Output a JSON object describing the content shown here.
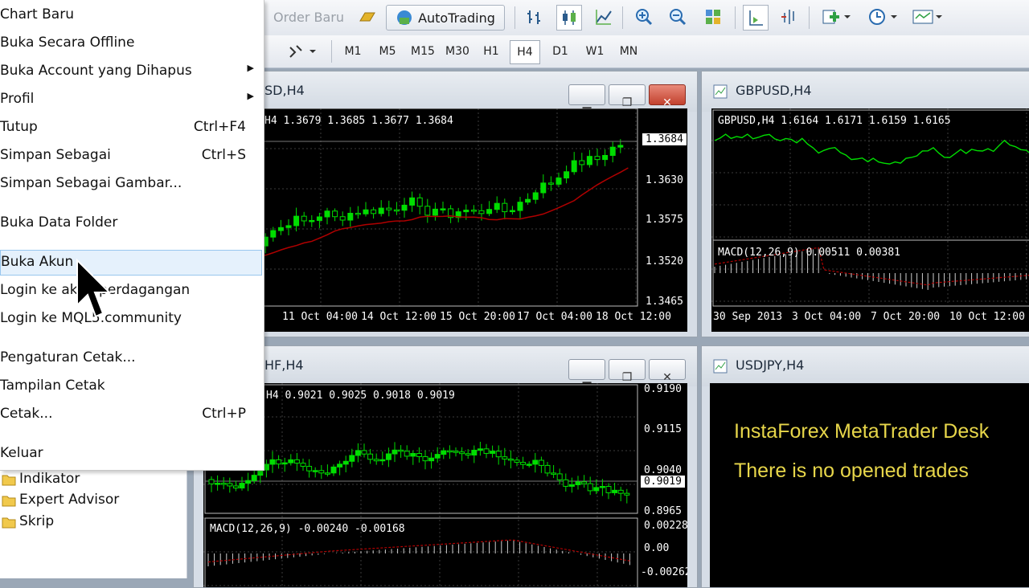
{
  "toolbar": {
    "order_baru": "Order Baru",
    "autotrading": "AutoTrading",
    "timeframes": [
      "M1",
      "M5",
      "M15",
      "M30",
      "H1",
      "H4",
      "D1",
      "W1",
      "MN"
    ],
    "selected_timeframe": "H4"
  },
  "file_menu": {
    "items": [
      {
        "label": "Chart Baru",
        "shortcut": ""
      },
      {
        "label": "Buka Secara Offline",
        "shortcut": ""
      },
      {
        "label": "Buka Account yang Dihapus",
        "shortcut": "",
        "submenu": true
      },
      {
        "label": "Profil",
        "shortcut": "",
        "submenu": true
      },
      {
        "label": "Tutup",
        "shortcut": "Ctrl+F4"
      },
      {
        "label": "Simpan Sebagai",
        "shortcut": "Ctrl+S"
      },
      {
        "label": "Simpan Sebagai Gambar...",
        "shortcut": ""
      },
      {
        "label": "Buka Data Folder",
        "shortcut": ""
      },
      {
        "label": "Buka Akun",
        "shortcut": "",
        "highlighted": true
      },
      {
        "label": "Login ke akun perdagangan",
        "shortcut": ""
      },
      {
        "label": "Login ke MQL5.community",
        "shortcut": ""
      },
      {
        "label": "Pengaturan Cetak...",
        "shortcut": ""
      },
      {
        "label": "Tampilan Cetak",
        "shortcut": ""
      },
      {
        "label": "Cetak...",
        "shortcut": "Ctrl+P"
      },
      {
        "label": "Keluar",
        "shortcut": ""
      }
    ]
  },
  "navigator": {
    "items": [
      "Indikator",
      "Expert Advisor",
      "Skrip"
    ]
  },
  "windows": {
    "eurusd": {
      "title": "SD,H4",
      "ohlc": "H4  1.3679 1.3685 1.3677 1.3684",
      "current_price": "1.3684",
      "price_labels": [
        "1.3630",
        "1.3575",
        "1.3520",
        "1.3465"
      ],
      "time_labels": [
        "11 Oct 04:00",
        "14 Oct 12:00",
        "15 Oct 20:00",
        "17 Oct 04:00",
        "18 Oct 12:00"
      ]
    },
    "gbpusd": {
      "title": "GBPUSD,H4",
      "ohlc": "GBPUSD,H4  1.6164 1.6171 1.6159 1.6165",
      "macd": "MACD(12,26,9) 0.00511 0.00381",
      "time_labels": [
        "30 Sep 2013",
        "3 Oct 04:00",
        "7 Oct 20:00",
        "10 Oct 12:00"
      ]
    },
    "usdchf": {
      "title": "HF,H4",
      "ohlc": "H4  0.9021 0.9025 0.9018 0.9019",
      "current_price": "0.9019",
      "price_labels": [
        "0.9190",
        "0.9115",
        "0.9040",
        "0.8965"
      ],
      "macd": "MACD(12,26,9) -0.00240 -0.00168",
      "macd_labels": [
        "0.00228",
        "0.00",
        "-0.00262"
      ]
    },
    "usdjpy": {
      "title": "USDJPY,H4",
      "message_line1": "InstaForex MetaTrader Desk",
      "message_line2": "There is no opened trades"
    }
  },
  "colors": {
    "bull_candle": "#00dd00",
    "moving_average": "#b00000",
    "chart_bg": "#000000",
    "info_text": "#e7d64a",
    "menu_highlight": "#e5f1fc"
  }
}
